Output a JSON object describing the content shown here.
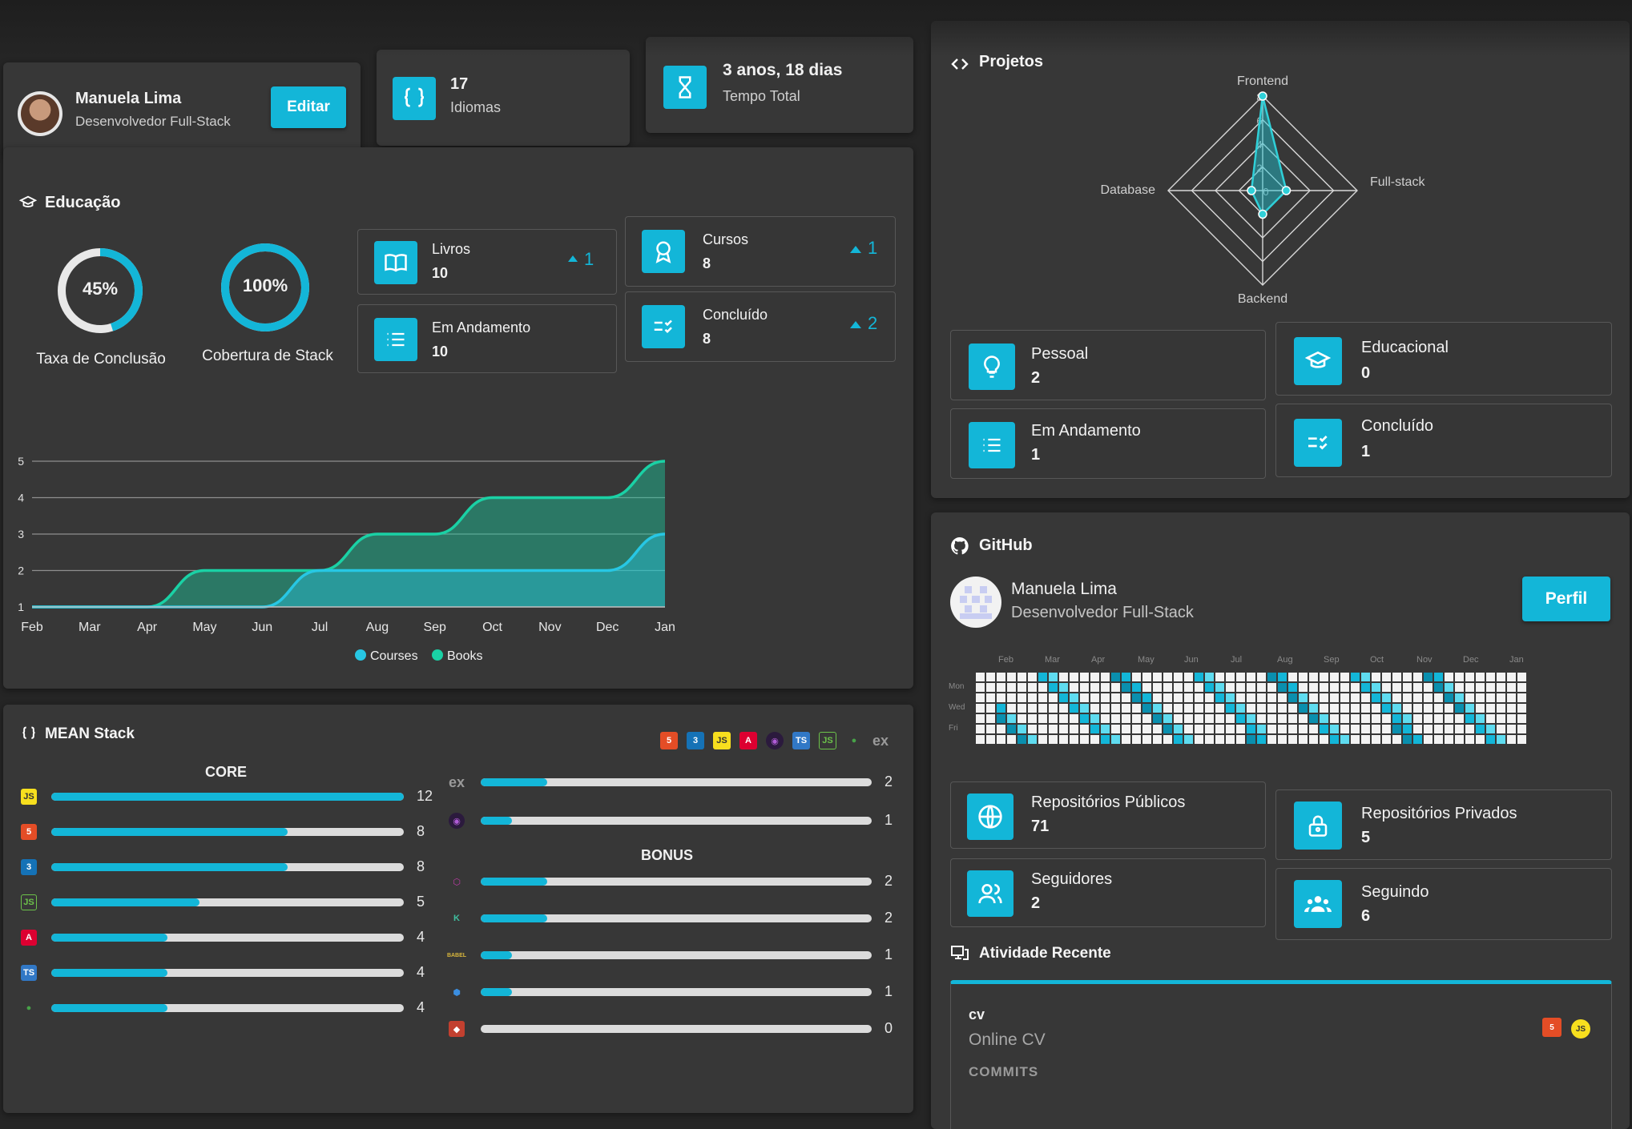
{
  "profile": {
    "name": "Manuela Lima",
    "role": "Desenvolvedor Full-Stack",
    "edit_label": "Editar"
  },
  "stats": {
    "languages_value": "17",
    "languages_label": "Idiomas",
    "time_value": "3 anos, 18 dias",
    "time_label": "Tempo Total"
  },
  "education": {
    "title": "Educação",
    "gauges": [
      {
        "value_text": "45%",
        "value": 45,
        "label": "Taxa de Conclusão"
      },
      {
        "value_text": "100%",
        "value": 100,
        "label": "Cobertura de Stack"
      }
    ],
    "tiles": [
      {
        "label": "Livros",
        "value": "10",
        "trend": "1",
        "icon": "book-icon"
      },
      {
        "label": "Cursos",
        "value": "8",
        "trend": "1",
        "icon": "award-icon"
      },
      {
        "label": "Em Andamento",
        "value": "10",
        "icon": "list-icon"
      },
      {
        "label": "Concluído",
        "value": "8",
        "trend": "2",
        "icon": "checklist-icon"
      }
    ]
  },
  "chart_data": {
    "type": "area",
    "x": [
      "Feb",
      "Mar",
      "Apr",
      "May",
      "Jun",
      "Jul",
      "Aug",
      "Sep",
      "Oct",
      "Nov",
      "Dec",
      "Jan"
    ],
    "series": [
      {
        "name": "Books",
        "values": [
          1,
          1,
          1,
          2,
          2,
          2,
          3,
          3,
          4,
          4,
          4,
          5
        ],
        "color": "#1ad1a5"
      },
      {
        "name": "Courses",
        "values": [
          1,
          1,
          1,
          1,
          1,
          2,
          2,
          2,
          2,
          2,
          2,
          3
        ],
        "color": "#27c7e4"
      }
    ],
    "yticks": [
      "1",
      "2",
      "3",
      "4",
      "5"
    ],
    "ylim": [
      1,
      5
    ],
    "legend_position": "bottom",
    "grid": true
  },
  "mean_stack": {
    "title": "MEAN Stack",
    "core_title": "CORE",
    "bonus_title": "BONUS",
    "header_icons": [
      "html5-icon",
      "css3-icon",
      "javascript-icon",
      "angular-icon",
      "redux-icon",
      "typescript-icon",
      "nodejs-icon",
      "mongodb-icon",
      "express-icon"
    ],
    "express_glyph": "ex",
    "core": [
      {
        "icon": "javascript-icon",
        "value": "12",
        "fraction": 1.0
      },
      {
        "icon": "html5-icon",
        "value": "8",
        "fraction": 0.67
      },
      {
        "icon": "css3-icon",
        "value": "8",
        "fraction": 0.67
      },
      {
        "icon": "nodejs-icon",
        "value": "5",
        "fraction": 0.42
      },
      {
        "icon": "angular-icon",
        "value": "4",
        "fraction": 0.33
      },
      {
        "icon": "typescript-icon",
        "value": "4",
        "fraction": 0.33
      },
      {
        "icon": "mongodb-icon",
        "value": "4",
        "fraction": 0.33
      }
    ],
    "core_extra": [
      {
        "icon": "express-icon",
        "value": "2",
        "fraction": 0.17
      },
      {
        "icon": "redux-icon",
        "value": "1",
        "fraction": 0.08
      }
    ],
    "bonus": [
      {
        "icon": "graphql-icon",
        "value": "2",
        "fraction": 0.17
      },
      {
        "icon": "kotlin-icon",
        "value": "2",
        "fraction": 0.17
      },
      {
        "icon": "babel-icon",
        "value": "1",
        "fraction": 0.08
      },
      {
        "icon": "hexagon-icon",
        "value": "1",
        "fraction": 0.08
      },
      {
        "icon": "git-icon",
        "value": "0",
        "fraction": 0.0
      }
    ]
  },
  "projects": {
    "title": "Projetos",
    "radar": {
      "axes": [
        "Frontend",
        "Full-stack",
        "Backend",
        "Database"
      ],
      "ticks": [
        "0",
        "2",
        "4",
        "6",
        "8"
      ],
      "values": [
        8,
        2,
        2,
        0
      ],
      "max": 8
    },
    "tiles": [
      {
        "label": "Pessoal",
        "value": "2",
        "icon": "lightbulb-icon"
      },
      {
        "label": "Educacional",
        "value": "0",
        "icon": "graduation-cap-icon"
      },
      {
        "label": "Em Andamento",
        "value": "1",
        "icon": "list-icon"
      },
      {
        "label": "Concluído",
        "value": "1",
        "icon": "checklist-icon"
      }
    ]
  },
  "github": {
    "title": "GitHub",
    "name": "Manuela Lima",
    "role": "Desenvolvedor Full-Stack",
    "profile_label": "Perfil",
    "months": [
      "Feb",
      "Mar",
      "Apr",
      "May",
      "Jun",
      "Jul",
      "Aug",
      "Sep",
      "Oct",
      "Nov",
      "Dec",
      "Jan"
    ],
    "days": [
      "Mon",
      "Wed",
      "Fri"
    ],
    "tiles": [
      {
        "label": "Repositórios Públicos",
        "value": "71",
        "icon": "globe-icon"
      },
      {
        "label": "Repositórios Privados",
        "value": "5",
        "icon": "lock-icon"
      },
      {
        "label": "Seguidores",
        "value": "2",
        "icon": "users-icon"
      },
      {
        "label": "Seguindo",
        "value": "6",
        "icon": "group-icon"
      }
    ],
    "activity_title": "Atividade Recente",
    "activity": {
      "repo": "cv",
      "description": "Online CV",
      "commits_label": "COMMITS",
      "tech_icons": [
        "html5-icon",
        "javascript-icon"
      ]
    }
  },
  "colors": {
    "accent": "#13b6d8",
    "books": "#1ad1a5",
    "courses": "#27c7e4",
    "card": "#373737",
    "background": "#252525"
  }
}
